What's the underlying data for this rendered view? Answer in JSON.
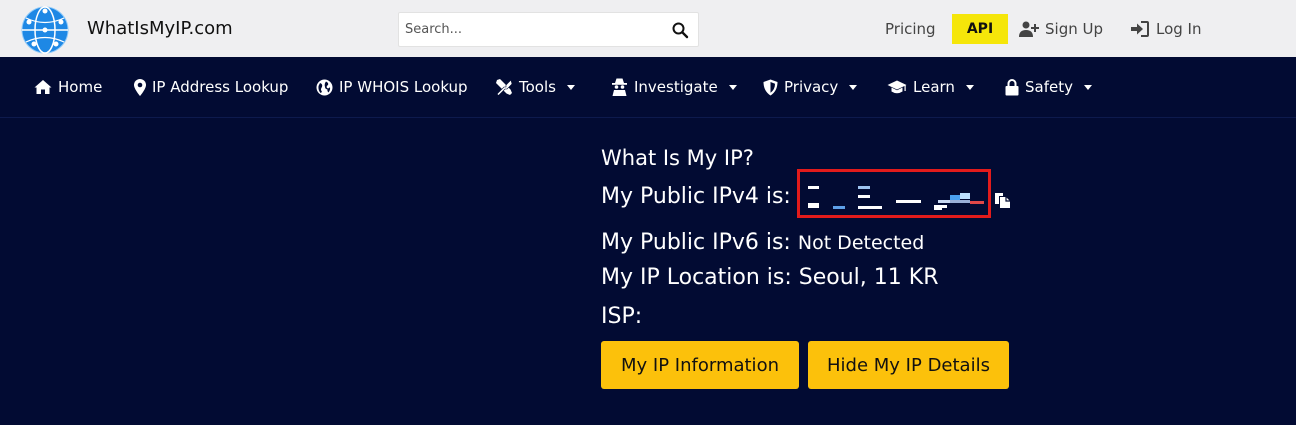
{
  "header": {
    "brand": "WhatIsMyIP.com",
    "search_placeholder": "Search...",
    "links": {
      "pricing": "Pricing",
      "api": "API",
      "signup": "Sign Up",
      "login": "Log In"
    }
  },
  "nav": {
    "items": [
      {
        "label": "Home",
        "icon": "home-icon"
      },
      {
        "label": "IP Address Lookup",
        "icon": "map-pin-icon"
      },
      {
        "label": "IP WHOIS Lookup",
        "icon": "globe-icon"
      },
      {
        "label": "Tools",
        "icon": "tools-icon"
      },
      {
        "label": "Investigate",
        "icon": "detective-icon"
      },
      {
        "label": "Privacy",
        "icon": "shield-icon"
      },
      {
        "label": "Learn",
        "icon": "graduation-cap-icon"
      },
      {
        "label": "Safety",
        "icon": "lock-icon"
      }
    ]
  },
  "main": {
    "title": "What Is My IP?",
    "ipv4_label": "My Public IPv4 is:",
    "ipv6_label": "My Public IPv6 is:",
    "ipv6_value": "Not Detected",
    "location_label": "My IP Location is:",
    "location_value": "Seoul, 11 KR",
    "isp_label": "ISP:",
    "buttons": {
      "info": "My IP Information",
      "hide": "Hide My IP Details"
    }
  },
  "colors": {
    "background": "#020b33",
    "topbar": "#efeff1",
    "api_badge": "#f5e60a",
    "button": "#fcc10b",
    "highlight_border": "#e21b1b"
  }
}
